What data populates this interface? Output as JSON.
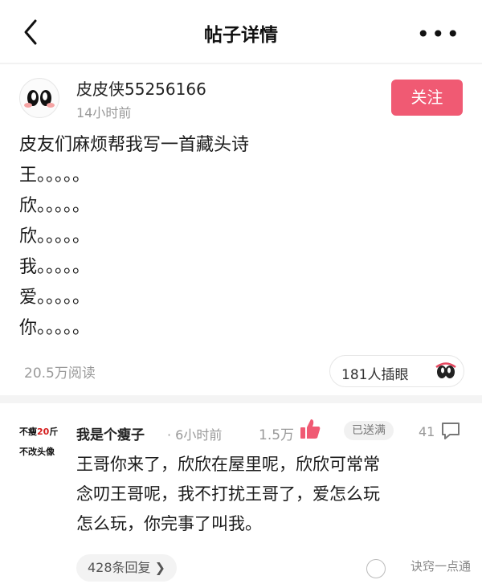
{
  "header": {
    "title": "帖子详情",
    "more_label": "•••"
  },
  "post": {
    "username": "皮皮侠55256166",
    "time": "14小时前",
    "follow_label": "关注",
    "lines": [
      "皮友们麻烦帮我写一首藏头诗",
      "王。。。。。",
      "欣。。。。。",
      "欣。。。。。",
      "我。。。。。",
      "爱。。。。。",
      "你。。。。。"
    ],
    "views": "20.5万阅读",
    "reaction_label": "181人插眼"
  },
  "comment": {
    "avatar_lines": [
      "不瘦",
      "20",
      "斤",
      "不改头像"
    ],
    "username": "我是个瘦子",
    "time": "· 6小时前",
    "likes": "1.5万",
    "badge": "已送满",
    "comment_count": "41",
    "lines": [
      "王哥你来了，欣欣在屋里呢，欣欣可常常",
      "念叨王哥呢，我不打扰王哥了，爱怎么玩",
      "怎么玩，你完事了叫我。"
    ],
    "replies_label": "428条回复 ❯"
  },
  "watermark": {
    "text": "诀窍一点通"
  }
}
